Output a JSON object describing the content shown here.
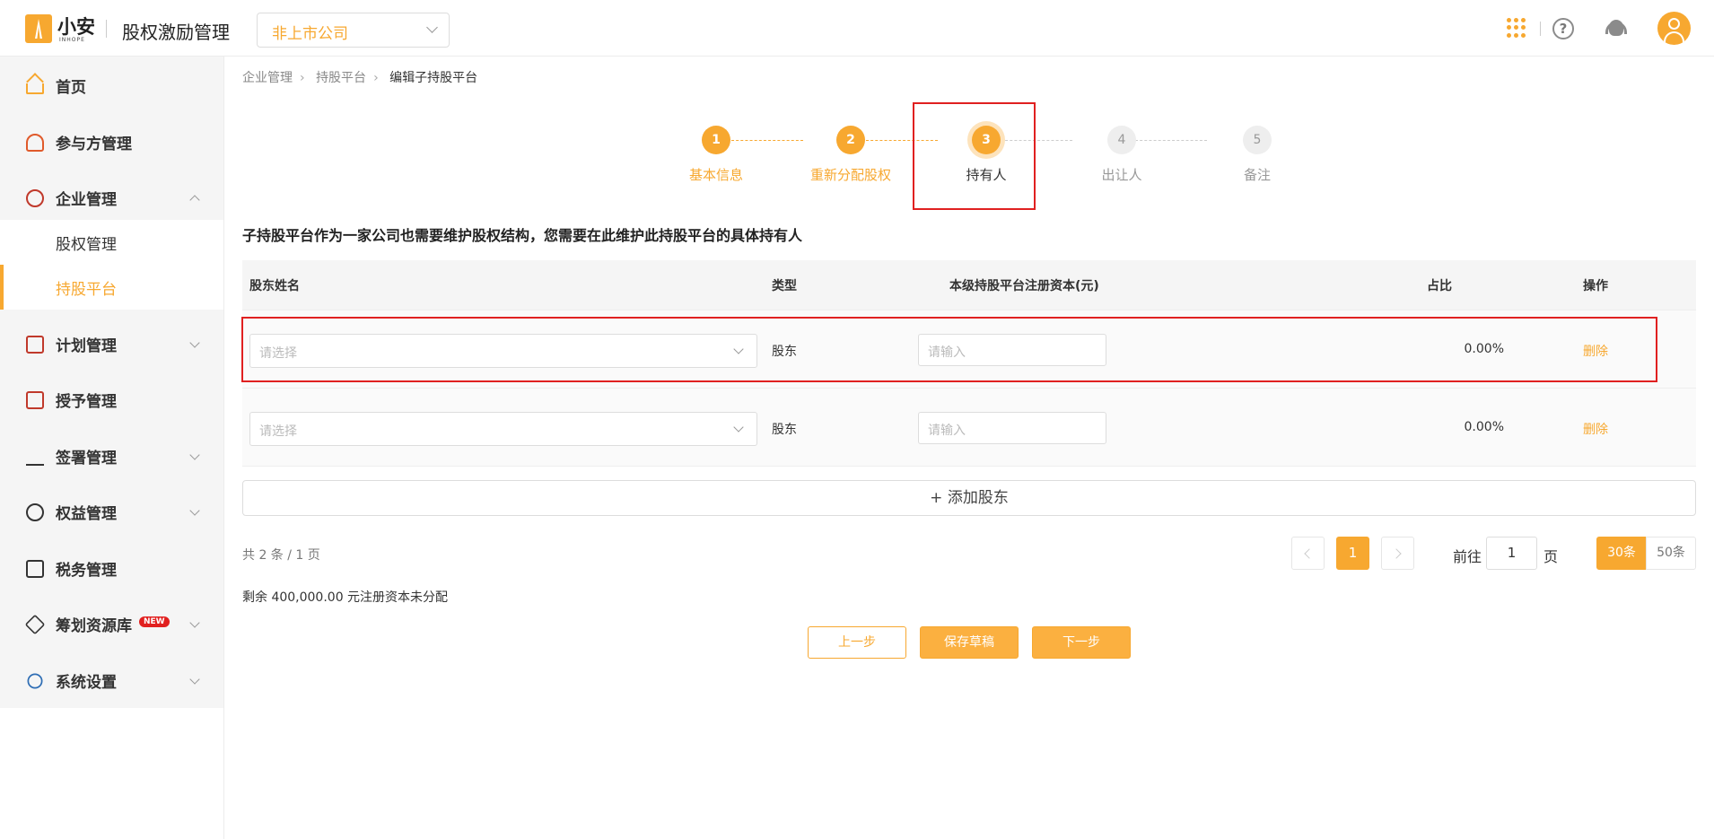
{
  "header": {
    "logo_text": "小安",
    "logo_sub": "INHOPE",
    "app_title": "股权激励管理",
    "company_select": "非上市公司"
  },
  "sidebar": {
    "items": [
      {
        "label": "首页",
        "icon": "home-icon"
      },
      {
        "label": "参与方管理",
        "icon": "users-icon"
      },
      {
        "label": "企业管理",
        "icon": "company-icon",
        "expanded": true,
        "children": [
          {
            "label": "股权管理"
          },
          {
            "label": "持股平台",
            "active": true
          }
        ]
      },
      {
        "label": "计划管理",
        "icon": "grid-icon"
      },
      {
        "label": "授予管理",
        "icon": "document-icon"
      },
      {
        "label": "签署管理",
        "icon": "sign-icon"
      },
      {
        "label": "权益管理",
        "icon": "badge-icon"
      },
      {
        "label": "税务管理",
        "icon": "tax-icon"
      },
      {
        "label": "筹划资源库",
        "icon": "layers-icon",
        "badge": "NEW"
      },
      {
        "label": "系统设置",
        "icon": "settings-icon"
      }
    ]
  },
  "breadcrumb": [
    "企业管理",
    "持股平台",
    "编辑子持股平台"
  ],
  "steps": [
    {
      "num": "1",
      "label": "基本信息",
      "state": "done"
    },
    {
      "num": "2",
      "label": "重新分配股权",
      "state": "done"
    },
    {
      "num": "3",
      "label": "持有人",
      "state": "current"
    },
    {
      "num": "4",
      "label": "出让人",
      "state": "todo"
    },
    {
      "num": "5",
      "label": "备注",
      "state": "todo"
    }
  ],
  "description": "子持股平台作为一家公司也需要维护股权结构，您需要在此维护此持股平台的具体持有人",
  "table": {
    "columns": [
      "股东姓名",
      "类型",
      "本级持股平台注册资本(元)",
      "占比",
      "操作"
    ],
    "rows": [
      {
        "name_placeholder": "请选择",
        "type": "股东",
        "capital_placeholder": "请输入",
        "ratio": "0.00%",
        "action": "删除"
      },
      {
        "name_placeholder": "请选择",
        "type": "股东",
        "capital_placeholder": "请输入",
        "ratio": "0.00%",
        "action": "删除"
      }
    ]
  },
  "add_button": "+ 添加股东",
  "pagination": {
    "total": "共 2 条 / 1 页",
    "current_page": "1",
    "goto_label": "前往",
    "goto_value": "1",
    "page_unit": "页",
    "size_30": "30条",
    "size_50": "50条"
  },
  "remaining": "剩余 400,000.00 元注册资本未分配",
  "actions": {
    "prev": "上一步",
    "save": "保存草稿",
    "next": "下一步"
  },
  "colors": {
    "accent": "#f7a830",
    "highlight": "#e02020"
  }
}
